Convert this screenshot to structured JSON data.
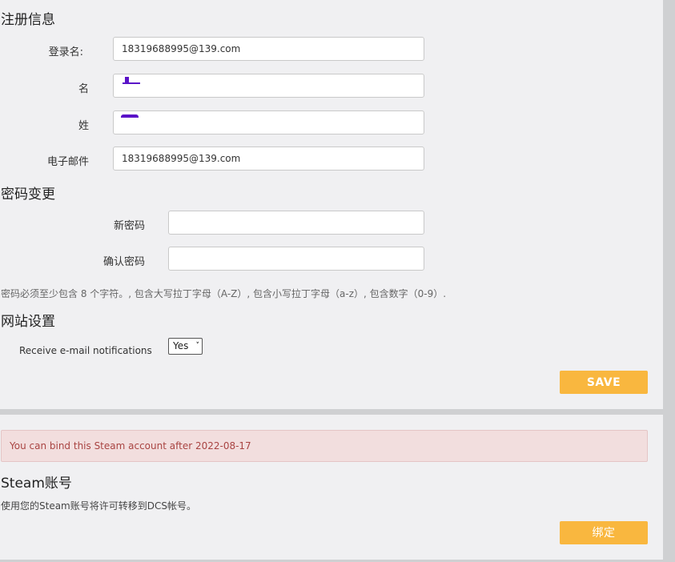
{
  "registration": {
    "title": "注册信息",
    "login_label": "登录名:",
    "login_value": "18319688995@139.com",
    "first_name_label": "名",
    "first_name_value": "",
    "last_name_label": "姓",
    "last_name_value": "",
    "email_label": "电子邮件",
    "email_value": "18319688995@139.com"
  },
  "password": {
    "title": "密码变更",
    "new_label": "新密码",
    "new_value": "",
    "confirm_label": "确认密码",
    "confirm_value": "",
    "hint": "密码必须至少包含 8 个字符。, 包含大写拉丁字母（A-Z）, 包含小写拉丁字母（a-z）, 包含数字（0-9）."
  },
  "site_settings": {
    "title": "网站设置",
    "notifications_label": "Receive e-mail notifications",
    "notifications_value": "Yes"
  },
  "save_label": "SAVE",
  "steam": {
    "alert": "You can bind this Steam account after 2022-08-17",
    "title": "Steam账号",
    "description": "使用您的Steam账号将许可转移到DCS帐号。",
    "bind_label": "绑定"
  },
  "colors": {
    "accent": "#f9b73f",
    "alert_bg": "#f2dede",
    "alert_text": "#a94442",
    "panel_bg": "#f0f0f2",
    "separator": "#cfd0d2"
  }
}
